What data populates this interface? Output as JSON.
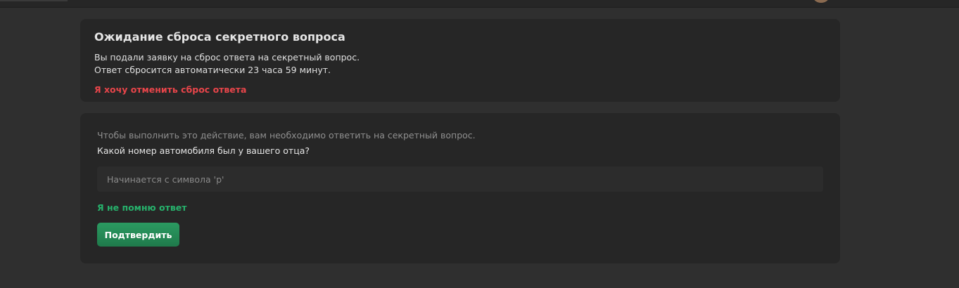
{
  "reset_request": {
    "title": "Ожидание сброса секретного вопроса",
    "line1": "Вы подали заявку на сброс ответа на секретный вопрос.",
    "line2": "Ответ сбросится автоматически 23 часа 59 минут.",
    "cancel_link": "Я хочу отменить сброс ответа"
  },
  "security_question": {
    "hint": "Чтобы выполнить это действие, вам необходимо ответить на секретный вопрос.",
    "question": "Какой номер автомобиля был у вашего отца?",
    "answer_value": "",
    "answer_placeholder": "Начинается с символа 'р'",
    "forgot_link": "Я не помню ответ",
    "confirm_label": "Подтвердить"
  },
  "colors": {
    "background": "#2f2f2f",
    "card": "#262626",
    "danger": "#e8454a",
    "accent_green": "#26b26c",
    "button_green": "#23895a"
  }
}
